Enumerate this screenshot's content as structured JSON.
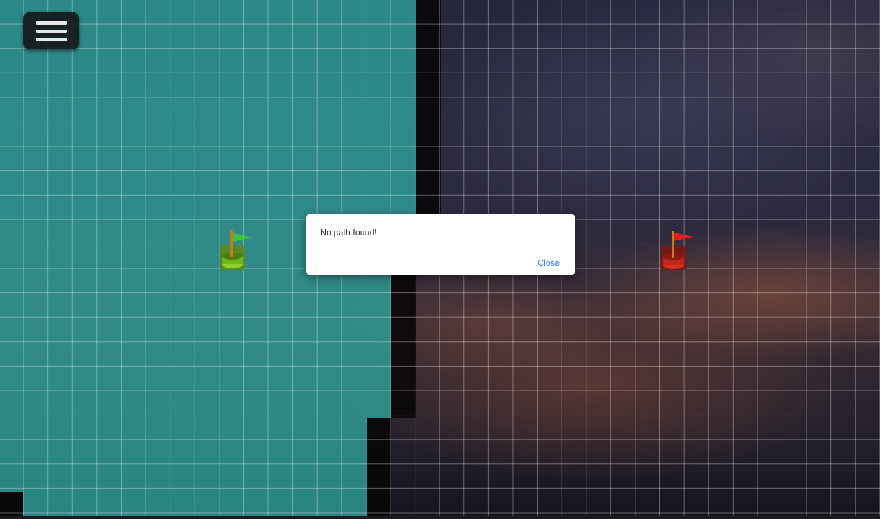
{
  "app": {
    "menu_icon": "hamburger-menu-icon"
  },
  "nodes": {
    "start": {
      "icon": "start-flag-icon",
      "color": "#7dbb1e",
      "flag_color": "#3cc43c"
    },
    "end": {
      "icon": "end-flag-icon",
      "color": "#c2261a",
      "flag_color": "#e02020"
    }
  },
  "colors": {
    "visited": "#30a59e",
    "wall": "#080608",
    "grid_line": "#ffffff"
  },
  "dialog": {
    "message": "No path found!",
    "close_label": "Close"
  }
}
